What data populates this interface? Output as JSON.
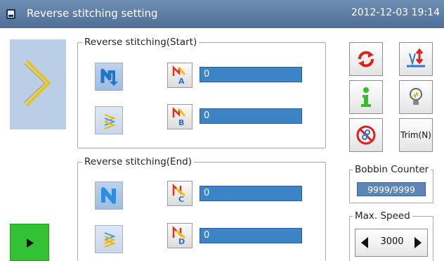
{
  "header": {
    "title": "Reverse stitching setting",
    "datetime": "2012-12-03  19:14"
  },
  "start_group": {
    "label": "Reverse stitching(Start)",
    "fields": [
      {
        "letter": "A",
        "value": "0"
      },
      {
        "letter": "B",
        "value": "0"
      }
    ]
  },
  "end_group": {
    "label": "Reverse stitching(End)",
    "fields": [
      {
        "letter": "C",
        "value": "0"
      },
      {
        "letter": "D",
        "value": "0"
      }
    ]
  },
  "tools": {
    "trim_label": "Trim(N)"
  },
  "bobbin": {
    "label": "Bobbin Counter",
    "value": "9999/9999"
  },
  "speed": {
    "label": "Max. Speed",
    "value": "3000"
  },
  "colors": {
    "accent": "#3c84c6",
    "header": "#5a7aa3",
    "play": "#33c233"
  }
}
